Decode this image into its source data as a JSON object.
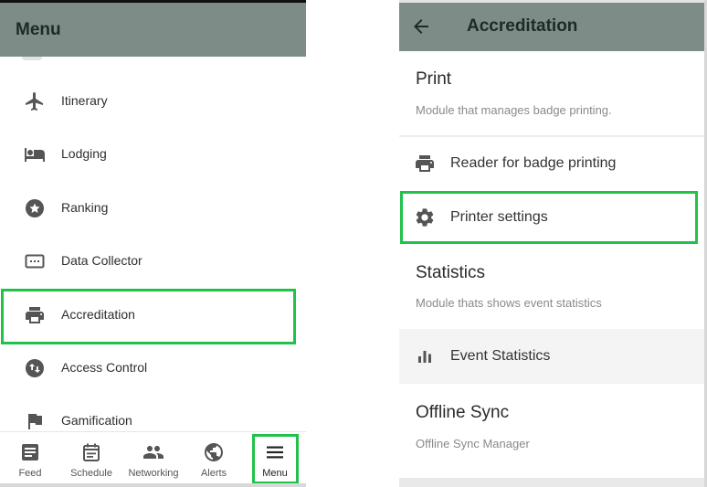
{
  "left": {
    "title": "Menu",
    "menu_items": [
      {
        "label": "Itinerary",
        "icon": "airplane-icon"
      },
      {
        "label": "Lodging",
        "icon": "bed-icon"
      },
      {
        "label": "Ranking",
        "icon": "star-circle-icon"
      },
      {
        "label": "Data Collector",
        "icon": "keyboard-icon"
      },
      {
        "label": "Accreditation",
        "icon": "printer-icon"
      },
      {
        "label": "Access Control",
        "icon": "swap-circle-icon"
      },
      {
        "label": "Gamification",
        "icon": "flag-icon"
      }
    ],
    "bottom_nav": [
      {
        "label": "Feed",
        "icon": "feed-icon"
      },
      {
        "label": "Schedule",
        "icon": "calendar-icon"
      },
      {
        "label": "Networking",
        "icon": "people-icon"
      },
      {
        "label": "Alerts",
        "icon": "globe-icon"
      },
      {
        "label": "Menu",
        "icon": "hamburger-icon"
      }
    ]
  },
  "right": {
    "title": "Accreditation",
    "sections": [
      {
        "title": "Print",
        "description": "Module that manages badge printing.",
        "items": [
          {
            "label": "Reader for badge printing",
            "icon": "printer-icon"
          },
          {
            "label": "Printer settings",
            "icon": "gear-icon"
          }
        ]
      },
      {
        "title": "Statistics",
        "description": "Module thats shows event statistics",
        "items": [
          {
            "label": "Event Statistics",
            "icon": "bar-chart-icon"
          }
        ]
      },
      {
        "title": "Offline Sync",
        "description": "Offline Sync Manager",
        "items": []
      }
    ]
  },
  "colors": {
    "appbar": "#7d8c87",
    "highlight": "#22c24a",
    "icon": "#555555"
  }
}
